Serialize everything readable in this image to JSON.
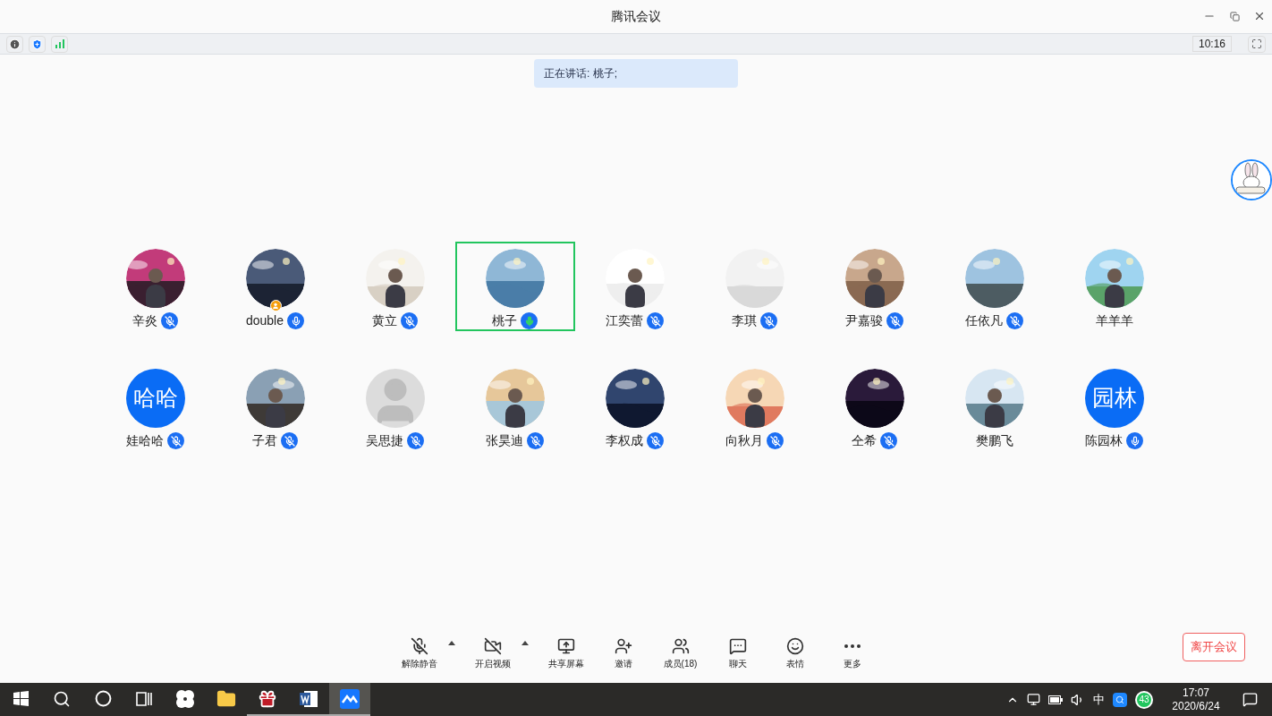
{
  "window": {
    "title": "腾讯会议"
  },
  "info_bar": {
    "timer": "10:16"
  },
  "speaking_banner": "正在讲话: 桃子;",
  "participants": [
    {
      "name": "辛炎",
      "kind": "picture",
      "has_mic": true,
      "muted": true,
      "speaking": false,
      "selected": false,
      "host": false
    },
    {
      "name": "double",
      "kind": "picture",
      "has_mic": true,
      "muted": false,
      "speaking": false,
      "selected": false,
      "host": true
    },
    {
      "name": "黄立",
      "kind": "picture",
      "has_mic": true,
      "muted": true,
      "speaking": false,
      "selected": false,
      "host": false
    },
    {
      "name": "桃子",
      "kind": "picture",
      "has_mic": true,
      "muted": false,
      "speaking": true,
      "selected": true,
      "host": false
    },
    {
      "name": "江奕蕾",
      "kind": "picture",
      "has_mic": true,
      "muted": true,
      "speaking": false,
      "selected": false,
      "host": false
    },
    {
      "name": "李琪",
      "kind": "picture",
      "has_mic": true,
      "muted": true,
      "speaking": false,
      "selected": false,
      "host": false
    },
    {
      "name": "尹嘉骏",
      "kind": "picture",
      "has_mic": true,
      "muted": true,
      "speaking": false,
      "selected": false,
      "host": false
    },
    {
      "name": "任依凡",
      "kind": "picture",
      "has_mic": true,
      "muted": true,
      "speaking": false,
      "selected": false,
      "host": false
    },
    {
      "name": "羊羊羊",
      "kind": "picture",
      "has_mic": false,
      "selected": false,
      "host": false
    },
    {
      "name": "娃哈哈",
      "kind": "initials",
      "initials": "哈哈",
      "has_mic": true,
      "muted": true,
      "speaking": false,
      "selected": false,
      "host": false
    },
    {
      "name": "子君",
      "kind": "picture",
      "has_mic": true,
      "muted": true,
      "speaking": false,
      "selected": false,
      "host": false
    },
    {
      "name": "吴思捷",
      "kind": "default",
      "has_mic": true,
      "muted": true,
      "speaking": false,
      "selected": false,
      "host": false
    },
    {
      "name": "张昊迪",
      "kind": "picture",
      "has_mic": true,
      "muted": true,
      "speaking": false,
      "selected": false,
      "host": false
    },
    {
      "name": "李权成",
      "kind": "picture",
      "has_mic": true,
      "muted": true,
      "speaking": false,
      "selected": false,
      "host": false
    },
    {
      "name": "向秋月",
      "kind": "picture",
      "has_mic": true,
      "muted": true,
      "speaking": false,
      "selected": false,
      "host": false
    },
    {
      "name": "仝希",
      "kind": "picture",
      "has_mic": true,
      "muted": true,
      "speaking": false,
      "selected": false,
      "host": false
    },
    {
      "name": "樊鹏飞",
      "kind": "picture",
      "has_mic": false,
      "selected": false,
      "host": false
    },
    {
      "name": "陈园林",
      "kind": "initials",
      "initials": "园林",
      "has_mic": true,
      "muted": false,
      "speaking": false,
      "selected": false,
      "host": false
    }
  ],
  "controls": [
    {
      "kind": "unmute",
      "label": "解除静音",
      "has_menu": true
    },
    {
      "kind": "video",
      "label": "开启视频",
      "has_menu": true
    },
    {
      "kind": "share",
      "label": "共享屏幕",
      "has_menu": false
    },
    {
      "kind": "invite",
      "label": "邀请",
      "has_menu": false
    },
    {
      "kind": "members",
      "label": "成员(18)",
      "has_menu": false
    },
    {
      "kind": "chat",
      "label": "聊天",
      "has_menu": false
    },
    {
      "kind": "emoji",
      "label": "表情",
      "has_menu": false
    },
    {
      "kind": "more",
      "label": "更多",
      "has_menu": false
    }
  ],
  "leave_button": "离开会议",
  "taskbar": {
    "apps": [
      {
        "running": false,
        "selected": false
      },
      {
        "running": false,
        "selected": false
      },
      {
        "running": false,
        "selected": false
      },
      {
        "running": false,
        "selected": false
      },
      {
        "running": false,
        "selected": false
      },
      {
        "running": false,
        "selected": false
      },
      {
        "running": true,
        "selected": false
      },
      {
        "running": true,
        "selected": false
      },
      {
        "running": true,
        "selected": true
      }
    ],
    "ime": "中",
    "badge": "43",
    "time": "17:07",
    "date": "2020/6/24"
  }
}
